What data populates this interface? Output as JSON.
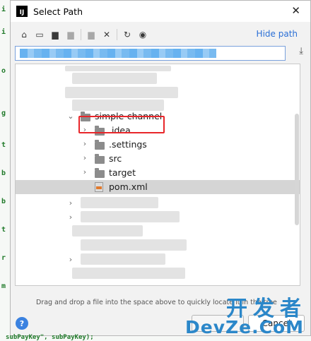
{
  "window": {
    "title": "Select Path",
    "app_icon_text": "IJ"
  },
  "toolbar": {
    "hide_path_label": "Hide path",
    "icons": [
      "home-icon",
      "desktop-icon",
      "project-folder-icon",
      "module-folder-icon",
      "new-folder-icon",
      "delete-icon",
      "refresh-icon",
      "show-hidden-icon"
    ]
  },
  "path": {
    "value": ""
  },
  "tree": {
    "items": [
      {
        "label": "simple-channel",
        "expanded": true,
        "kind": "folder"
      },
      {
        "label": ".idea",
        "kind": "folder"
      },
      {
        "label": ".settings",
        "kind": "folder"
      },
      {
        "label": "src",
        "kind": "folder"
      },
      {
        "label": "target",
        "kind": "folder"
      },
      {
        "label": "pom.xml",
        "kind": "xml-file",
        "selected": true
      }
    ]
  },
  "hint": "Drag and drop a file into the space above to quickly locate it in the tree",
  "buttons": {
    "ok_label": "",
    "cancel_label": "Cancel"
  },
  "watermark": {
    "line1": "开发者",
    "line2": "DevZe.CoM"
  },
  "colors": {
    "accent": "#2a6fd6",
    "highlight_box": "#e8262a",
    "selection": "#d5d5d5"
  },
  "background_code": {
    "line": "subPayKey\",  subPayKey);"
  }
}
